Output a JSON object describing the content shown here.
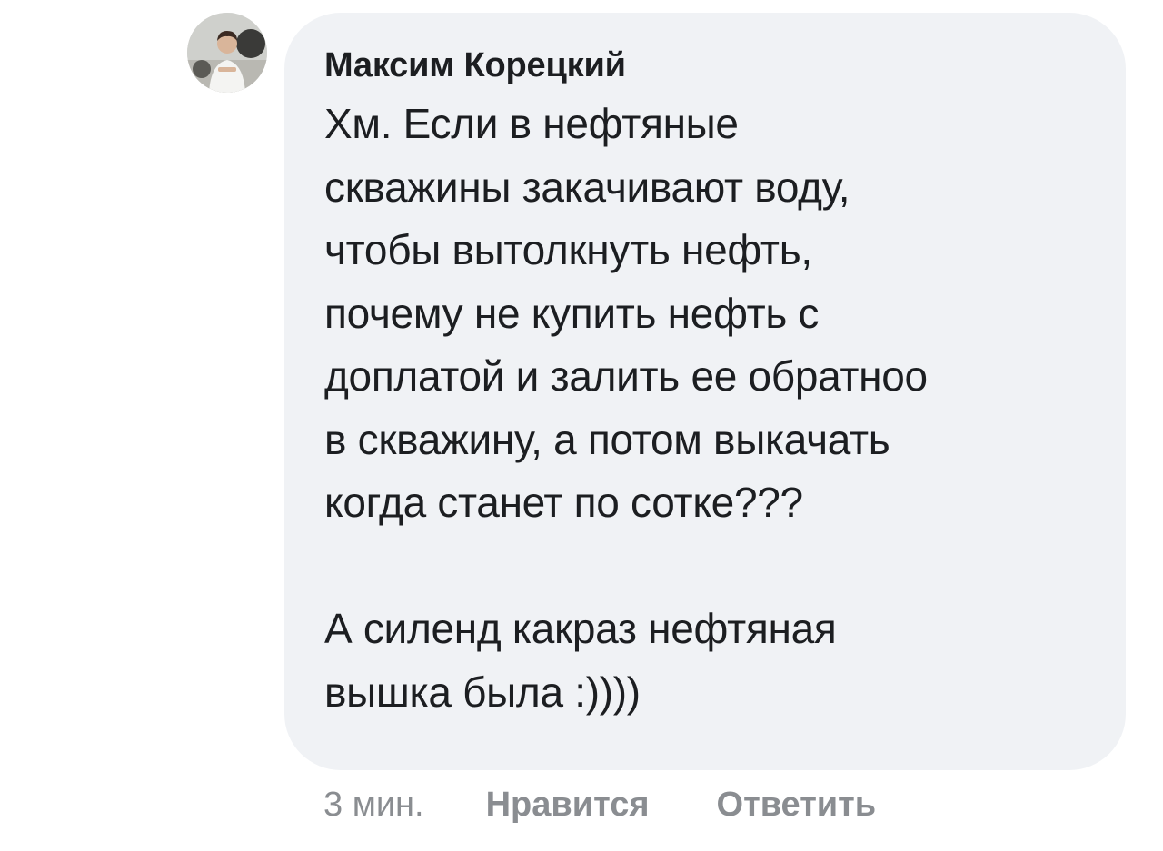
{
  "comment": {
    "author": "Максим Корецкий",
    "text": "Хм. Если в нефтяные\nскважины закачивают воду,\nчтобы вытолкнуть нефть,\nпочему не купить нефть с\nдоплатой и залить ее обратноо\nв скважину, а потом выкачать\nкогда станет по сотке???\n\nА силенд какраз нефтяная\nвышка была :))))",
    "time": "3 мин.",
    "like_label": "Нравится",
    "reply_label": "Ответить"
  },
  "colors": {
    "bubble_background": "#f0f2f5",
    "text": "#1c1e21",
    "secondary_text": "#8a8d91"
  }
}
